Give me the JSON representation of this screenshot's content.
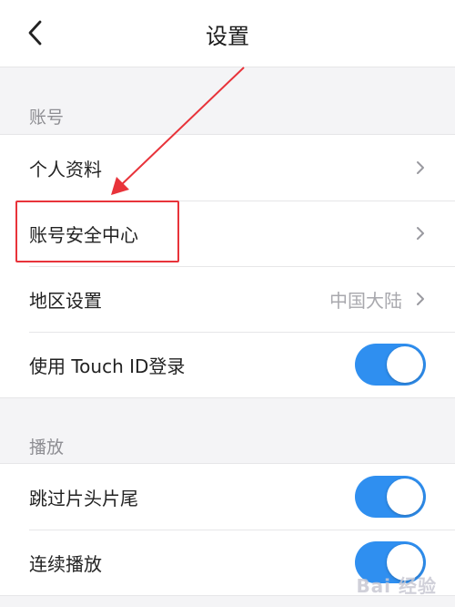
{
  "nav": {
    "title": "设置"
  },
  "sections": {
    "account": {
      "header": "账号",
      "rows": [
        {
          "label": "个人资料"
        },
        {
          "label": "账号安全中心"
        },
        {
          "label": "地区设置",
          "value": "中国大陆"
        },
        {
          "label": "使用 Touch ID登录",
          "toggle": true
        }
      ]
    },
    "playback": {
      "header": "播放",
      "rows": [
        {
          "label": "跳过片头片尾",
          "toggle": true
        },
        {
          "label": "连续播放",
          "toggle": true
        }
      ]
    }
  },
  "colors": {
    "accent": "#2f8ff0",
    "annotation": "#e8333a"
  },
  "watermark": "Bai 经验"
}
